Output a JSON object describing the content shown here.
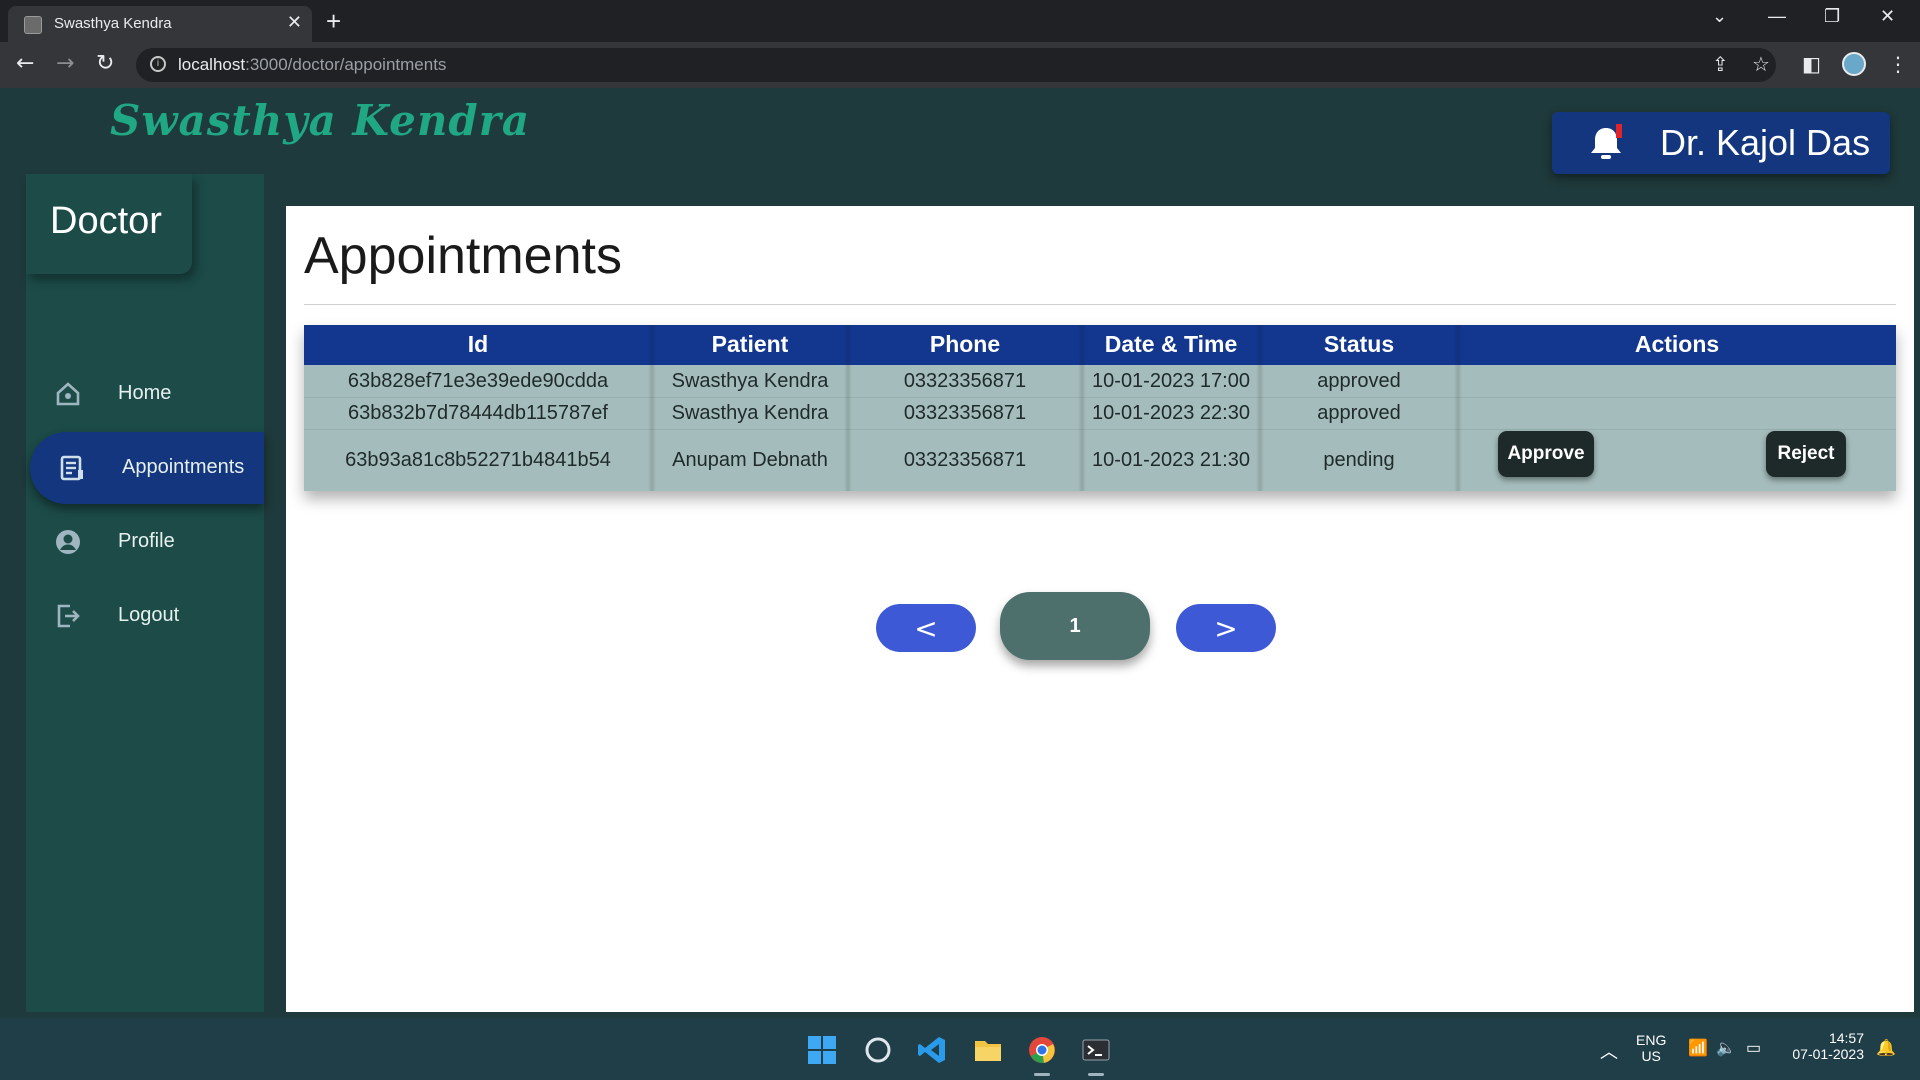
{
  "browser": {
    "tab_title": "Swasthya Kendra",
    "url_host": "localhost",
    "url_path": ":3000/doctor/appointments"
  },
  "header": {
    "brand": "Swasthya Kendra",
    "user_name": "Dr. Kajol Das"
  },
  "sidebar": {
    "title": "Doctor",
    "items": [
      {
        "label": "Home",
        "icon": "home-icon"
      },
      {
        "label": "Appointments",
        "icon": "document-icon",
        "active": true
      },
      {
        "label": "Profile",
        "icon": "user-icon"
      },
      {
        "label": "Logout",
        "icon": "logout-icon"
      }
    ]
  },
  "main": {
    "title": "Appointments",
    "columns": [
      "Id",
      "Patient",
      "Phone",
      "Date & Time",
      "Status",
      "Actions"
    ],
    "rows": [
      {
        "id": "63b828ef71e3e39ede90cdda",
        "patient": "Swasthya Kendra",
        "phone": "03323356871",
        "datetime": "10-01-2023 17:00",
        "status": "approved"
      },
      {
        "id": "63b832b7d78444db115787ef",
        "patient": "Swasthya Kendra",
        "phone": "03323356871",
        "datetime": "10-01-2023 22:30",
        "status": "approved"
      },
      {
        "id": "63b93a81c8b52271b4841b54",
        "patient": "Anupam Debnath",
        "phone": "03323356871",
        "datetime": "10-01-2023 21:30",
        "status": "pending"
      }
    ],
    "actions": {
      "approve": "Approve",
      "reject": "Reject"
    },
    "pagination": {
      "prev": "<",
      "page": "1",
      "next": ">"
    }
  },
  "taskbar": {
    "lang": "ENG",
    "region": "US",
    "time": "14:57",
    "date": "07-01-2023"
  },
  "colors": {
    "brand": "#1fa883",
    "header_blue": "#13367f",
    "sidebar": "#1c4b48",
    "table_body": "#a4bcbb",
    "pager_blue": "#3d59d6"
  }
}
